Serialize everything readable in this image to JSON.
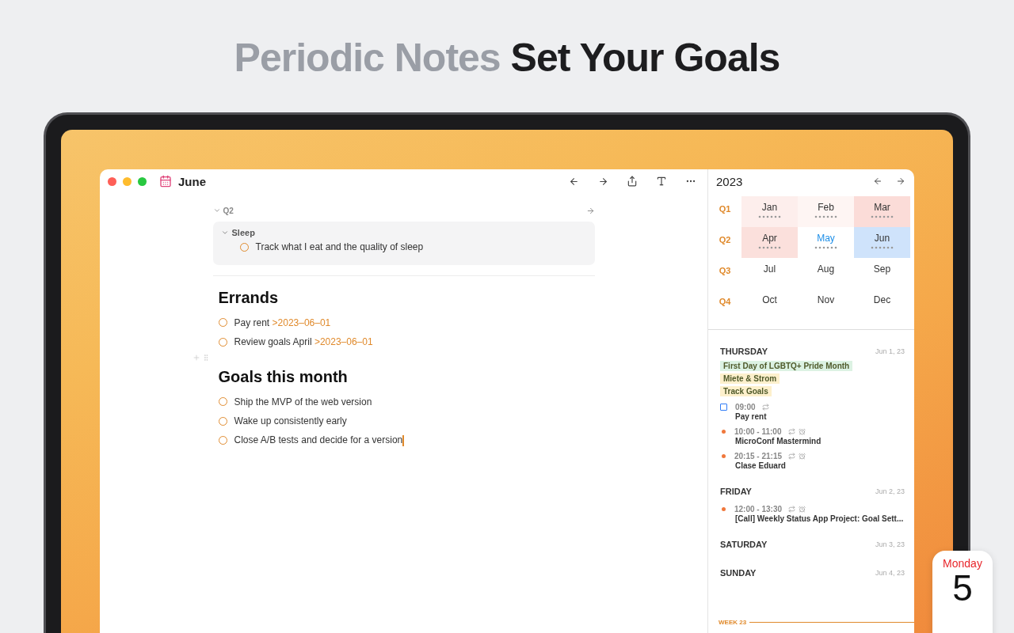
{
  "headline": {
    "muted": "Periodic Notes",
    "strong": "Set Your Goals"
  },
  "window": {
    "title": "June"
  },
  "note": {
    "section": {
      "label": "Q2",
      "expanded": true
    },
    "group": {
      "label": "Sleep",
      "expanded": true,
      "tasks": [
        {
          "text": "Track what I eat and the quality of sleep",
          "done": false,
          "cursor": false
        }
      ]
    },
    "blocks": [
      {
        "heading": "Errands",
        "tasks": [
          {
            "text": "Pay rent",
            "date": ">2023–06–01",
            "done": false,
            "cursor": false
          },
          {
            "text": "Review goals April",
            "date": ">2023–06–01",
            "done": false,
            "cursor": false
          }
        ]
      },
      {
        "heading": "Goals this month",
        "tasks": [
          {
            "text": "Ship the MVP of the web version",
            "done": false,
            "cursor": false
          },
          {
            "text": "Wake up consistently early",
            "done": false,
            "cursor": false
          },
          {
            "text": "Close A/B tests and decide for a version",
            "done": false,
            "cursor": true
          }
        ]
      }
    ]
  },
  "calendar": {
    "year": "2023",
    "quarters": [
      {
        "label": "Q1",
        "months": [
          {
            "name": "Jan",
            "color": "#fdeeec",
            "marks": true,
            "current": false
          },
          {
            "name": "Feb",
            "color": "#fef5f3",
            "marks": true,
            "current": false
          },
          {
            "name": "Mar",
            "color": "#fbdcd8",
            "marks": true,
            "current": false
          }
        ]
      },
      {
        "label": "Q2",
        "months": [
          {
            "name": "Apr",
            "color": "#fbe0dc",
            "marks": true,
            "current": false
          },
          {
            "name": "May",
            "marks": true,
            "current": true
          },
          {
            "name": "Jun",
            "color": "#cfe3fb",
            "marks": true,
            "current": false
          }
        ]
      },
      {
        "label": "Q3",
        "months": [
          {
            "name": "Jul",
            "marks": false,
            "current": false
          },
          {
            "name": "Aug",
            "marks": false,
            "current": false
          },
          {
            "name": "Sep",
            "marks": false,
            "current": false
          }
        ]
      },
      {
        "label": "Q4",
        "months": [
          {
            "name": "Oct",
            "marks": false,
            "current": false
          },
          {
            "name": "Nov",
            "marks": false,
            "current": false
          },
          {
            "name": "Dec",
            "marks": false,
            "current": false
          }
        ]
      }
    ]
  },
  "agenda": {
    "days": [
      {
        "name": "THURSDAY",
        "date": "Jun 1, 23",
        "all_day": [
          {
            "title": "First Day of LGBTQ+ Pride Month",
            "color": "#dcf2e3"
          },
          {
            "title": "Miete & Strom",
            "color": "#fdf0cc"
          },
          {
            "title": "Track Goals",
            "color": "#fdf0cc"
          }
        ],
        "events": [
          {
            "kind": "task",
            "time": "09:00",
            "title": "Pay rent",
            "repeat": true,
            "alarm": false,
            "color": "#2f7cf6"
          },
          {
            "kind": "event",
            "time": "10:00 - 11:00",
            "title": "MicroConf Mastermind",
            "repeat": true,
            "alarm": true,
            "color": "#f0783c"
          },
          {
            "kind": "event",
            "time": "20:15 - 21:15",
            "title": "Clase Eduard",
            "repeat": true,
            "alarm": true,
            "color": "#f0783c"
          }
        ]
      },
      {
        "name": "FRIDAY",
        "date": "Jun 2, 23",
        "events": [
          {
            "kind": "event",
            "time": "12:00 - 13:30",
            "title": "[Call] Weekly Status App Project: Goal Sett...",
            "repeat": true,
            "alarm": true,
            "color": "#f0783c"
          }
        ]
      },
      {
        "name": "SATURDAY",
        "date": "Jun 3, 23"
      },
      {
        "name": "SUNDAY",
        "date": "Jun 4, 23"
      }
    ],
    "week_marker": "WEEK 23"
  },
  "app_icon": {
    "day": "Monday",
    "date": "5"
  }
}
